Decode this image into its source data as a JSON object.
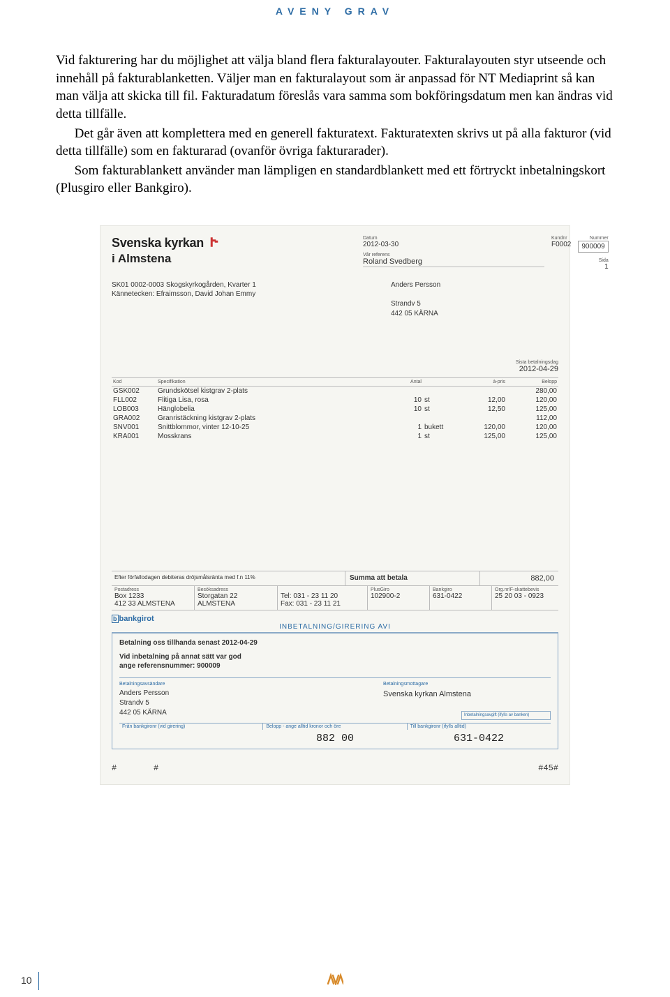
{
  "header": {
    "title": "AVENY GRAV"
  },
  "body": {
    "p1": "Vid fakturering har du möjlighet att välja bland flera fakturalayouter. Fakturalayouten styr utseende och innehåll på fakturablanketten. Väljer man en fakturalayout som är anpassad för NT Mediaprint så kan man välja att skicka till fil. Fakturadatum föreslås vara samma som bokföringsdatum men kan ändras vid detta tillfälle.",
    "p2": "Det går även att komplettera med en generell fakturatext. Fakturatexten skrivs ut på alla fakturor (vid detta tillfälle) som en fakturarad (ovanför övriga fakturarader).",
    "p3": "Som fakturablankett använder man lämpligen en standardblankett med ett förtryckt inbetalningskort (Plusgiro eller Bankgiro)."
  },
  "invoice": {
    "brand1": "Svenska kyrkan",
    "brand2": "i Almstena",
    "meta": {
      "datum_label": "Datum",
      "datum": "2012-03-30",
      "kundnr_label": "Kundnr",
      "kundnr": "F0002",
      "nummer_label": "Nummer",
      "nummer": "900009",
      "sida_label": "Sida",
      "sida": "1",
      "ref_label": "Vår referens",
      "ref": "Roland Svedberg"
    },
    "left_addr": {
      "l1": "SK01 0002-0003 Skogskyrkogården, Kvarter 1",
      "l2": "Kännetecken: Efraimsson, David Johan Emmy"
    },
    "right_addr": {
      "l1": "Anders Persson",
      "l2": "Strandv 5",
      "l3": "442 05 KÄRNA"
    },
    "due": {
      "label": "Sista betalningsdag",
      "value": "2012-04-29"
    },
    "cols": {
      "kod": "Kod",
      "spec": "Specifikation",
      "antal": "Antal",
      "apris": "à-pris",
      "belopp": "Belopp"
    },
    "lines": [
      {
        "kod": "GSK002",
        "spec": "Grundskötsel kistgrav 2-plats",
        "antal": "",
        "enh": "",
        "apris": "",
        "belopp": "280,00"
      },
      {
        "kod": "FLL002",
        "spec": "Flitiga Lisa, rosa",
        "antal": "10",
        "enh": "st",
        "apris": "12,00",
        "belopp": "120,00"
      },
      {
        "kod": "LOB003",
        "spec": "Hänglobelia",
        "antal": "10",
        "enh": "st",
        "apris": "12,50",
        "belopp": "125,00"
      },
      {
        "kod": "GRA002",
        "spec": "Granristäckning kistgrav 2-plats",
        "antal": "",
        "enh": "",
        "apris": "",
        "belopp": "112,00"
      },
      {
        "kod": "SNV001",
        "spec": "Snittblommor, vinter 12-10-25",
        "antal": "1",
        "enh": "bukett",
        "apris": "120,00",
        "belopp": "120,00"
      },
      {
        "kod": "KRA001",
        "spec": "Mosskrans",
        "antal": "1",
        "enh": "st",
        "apris": "125,00",
        "belopp": "125,00"
      }
    ],
    "late": "Efter förfallodagen debiteras dröjsmålsränta med f.n 11%",
    "sum_label": "Summa att betala",
    "sum_amount": "882,00",
    "biller": {
      "post_label": "Postadress",
      "post1": "Box 1233",
      "post2": "412 33  ALMSTENA",
      "visit_label": "Besöksadress",
      "visit1": "Storgatan 22",
      "visit2": "ALMSTENA",
      "tel": "Tel: 031 - 23 11 20",
      "fax": "Fax: 031 - 23 11 21",
      "plusgiro_label": "PlusGiro",
      "plusgiro": "102900-2",
      "bankgiro_label": "Bankgiro",
      "bankgiro": "631-0422",
      "org_label": "Org.nr/F-skattebevis",
      "org": "25 20 03 - 0923"
    },
    "giro": {
      "brand": "bankgirot",
      "title": "INBETALNING/GIRERING  AVI",
      "pay_by": "Betalning oss tillhanda senast 2012-04-29",
      "alt1": "Vid inbetalning på annat sätt var god",
      "alt2": "ange referensnummer: 900009",
      "sender_label": "Betalningsavsändare",
      "s1": "Anders Persson",
      "s2": "Strandv 5",
      "s3": "442 05 KÄRNA",
      "recv_label": "Betalningsmottagare",
      "recv": "Svenska kyrkan Almstena",
      "avgift": "Inbetalningsavgift (ifylls av banken)",
      "bl1": "Från bankgironr (vid girering)",
      "bl2": "Belopp - ange alltid kronor och öre",
      "bl3": "Till bankgironr (ifylls alltid)",
      "amount": "882  00",
      "to_bg": "631-0422",
      "ocr_l": "#",
      "ocr_m": "#",
      "ocr_r": "#45#"
    }
  },
  "footer": {
    "page_number": "10"
  }
}
